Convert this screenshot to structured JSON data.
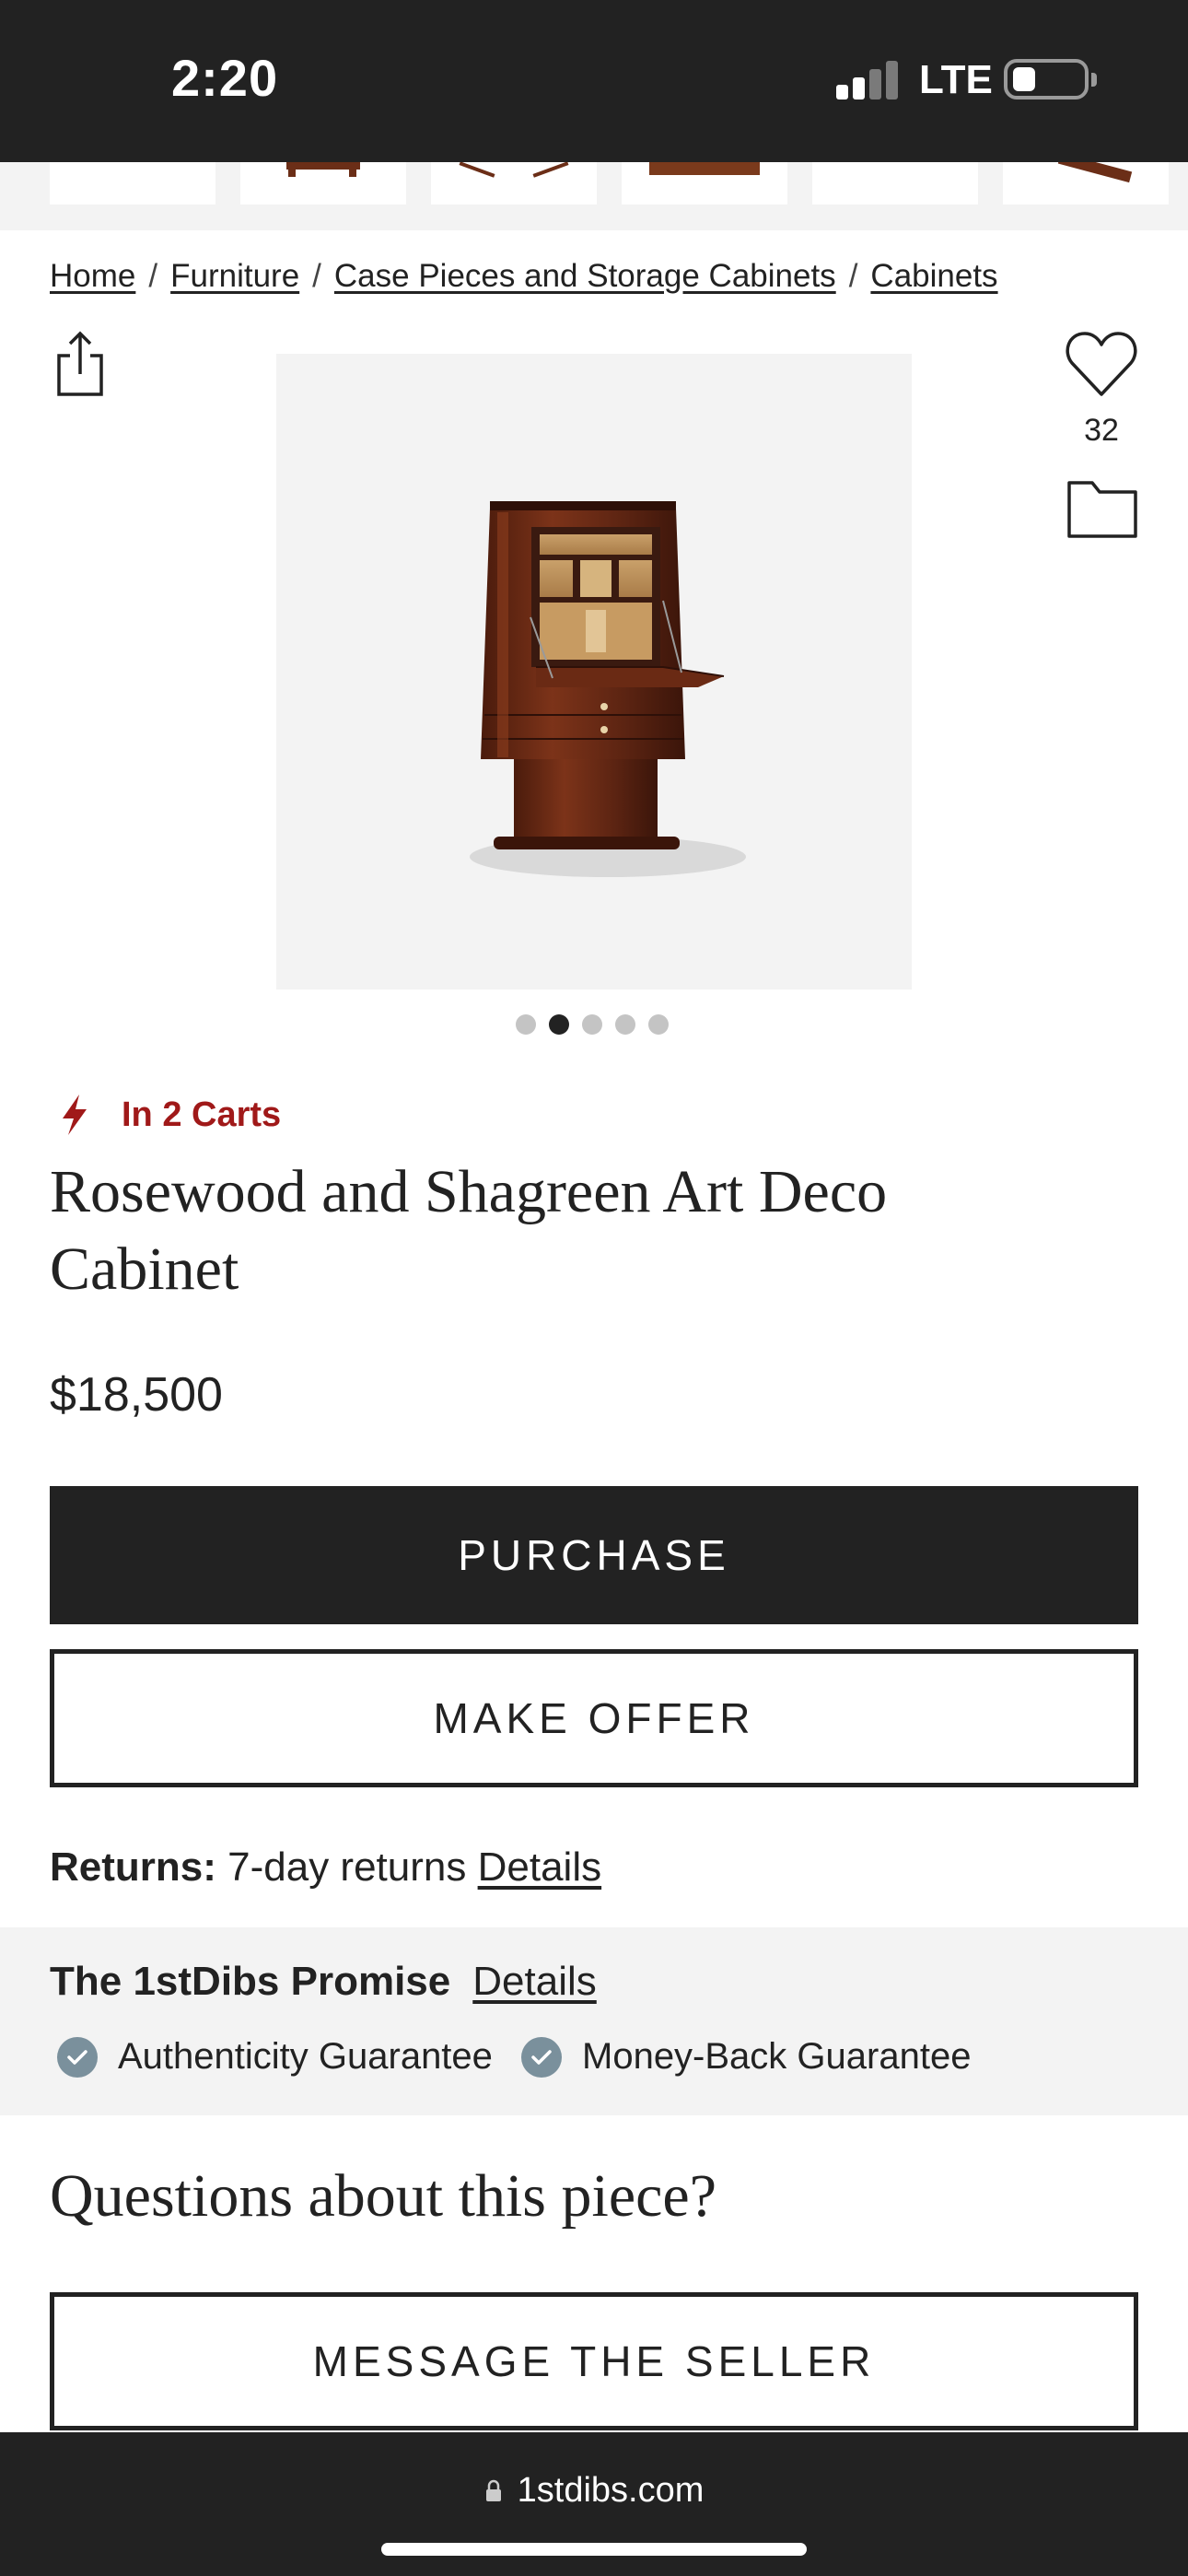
{
  "status_bar": {
    "time": "2:20",
    "network": "LTE",
    "signal_bars_active": 2,
    "signal_bars_total": 4,
    "battery_level": 0.2
  },
  "breadcrumb": {
    "items": [
      {
        "label": "Home"
      },
      {
        "label": "Furniture"
      },
      {
        "label": "Case Pieces and Storage Cabinets"
      },
      {
        "label": "Cabinets"
      }
    ],
    "separator": "/"
  },
  "actions": {
    "favorites_count": "32",
    "share_icon": "share-icon",
    "favorite_icon": "heart-icon",
    "folder_icon": "folder-icon"
  },
  "gallery": {
    "image_count": 5,
    "active_index": 1,
    "image_subject": "cabinet"
  },
  "product": {
    "in_carts": "In 2 Carts",
    "title": "Rosewood and Shagreen Art Deco Cabinet",
    "price": "$18,500"
  },
  "buttons": {
    "purchase": "PURCHASE",
    "make_offer": "MAKE OFFER",
    "message_seller": "MESSAGE THE SELLER"
  },
  "returns": {
    "label": "Returns:",
    "value": "7-day returns",
    "details": "Details"
  },
  "promise": {
    "title": "The 1stDibs Promise",
    "details": "Details",
    "guarantees": [
      "Authenticity Guarantee",
      "Money-Back Guarantee"
    ]
  },
  "questions": {
    "heading": "Questions about this piece?"
  },
  "browser": {
    "url": "1stdibs.com"
  },
  "colors": {
    "dark": "#222222",
    "alert_red": "#a01919",
    "check_blue_gray": "#7a909c",
    "panel_gray": "#f3f3f3"
  }
}
